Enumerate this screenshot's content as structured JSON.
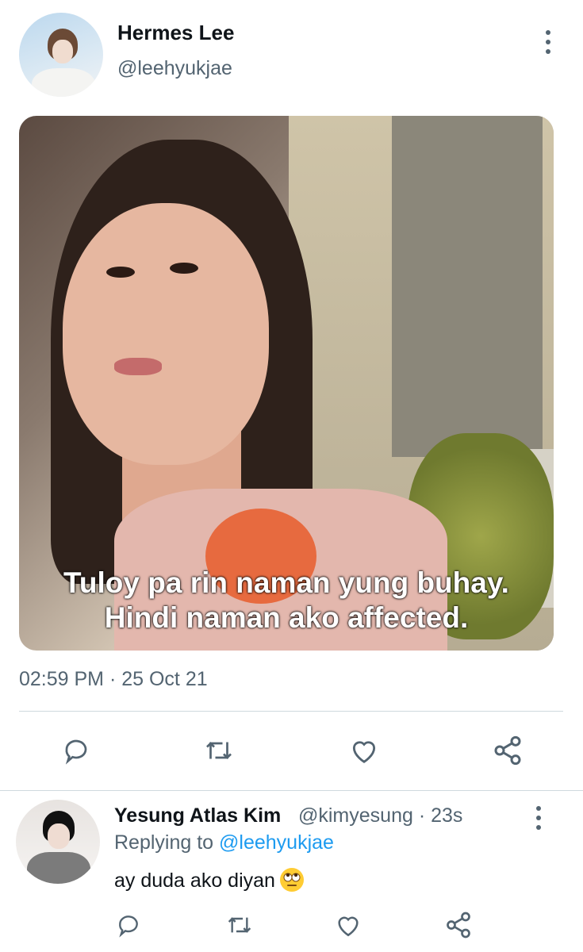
{
  "tweet": {
    "author_name": "Hermes Lee",
    "author_handle": "@leehyukjae",
    "image_caption_line1": "Tuloy pa rin naman yung buhay.",
    "image_caption_line2": "Hindi naman ako affected.",
    "timestamp": "02:59 PM · 25 Oct 21"
  },
  "reply": {
    "author_name": "Yesung Atlas Kim",
    "author_handle": "@kimyesung · 23s",
    "replying_prefix": "Replying to ",
    "replying_handle": "@leehyukjae",
    "text": "ay duda ako diyan",
    "emoji": "face-with-rolling-eyes-emoji"
  },
  "icons": {
    "reply": "comment-icon",
    "retweet": "retweet-icon",
    "like": "heart-icon",
    "share": "share-icon",
    "more": "more-options-icon"
  },
  "colors": {
    "text": "#0f1419",
    "secondary": "#536471",
    "link": "#1d9bf0",
    "divider": "#cfd9de"
  }
}
